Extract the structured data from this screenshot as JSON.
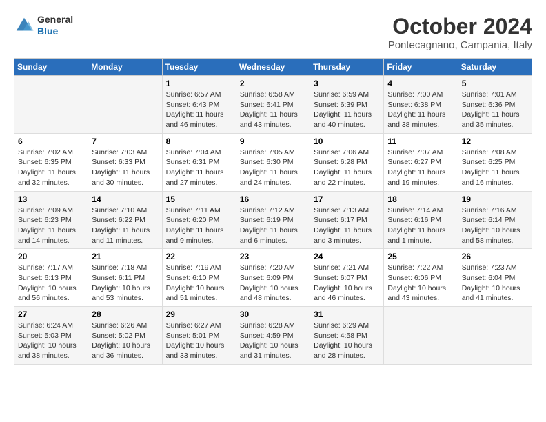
{
  "header": {
    "logo": {
      "general": "General",
      "blue": "Blue"
    },
    "title": "October 2024",
    "location": "Pontecagnano, Campania, Italy"
  },
  "weekdays": [
    "Sunday",
    "Monday",
    "Tuesday",
    "Wednesday",
    "Thursday",
    "Friday",
    "Saturday"
  ],
  "weeks": [
    [
      null,
      null,
      {
        "day": 1,
        "sunrise": "6:57 AM",
        "sunset": "6:43 PM",
        "daylight": "11 hours and 46 minutes."
      },
      {
        "day": 2,
        "sunrise": "6:58 AM",
        "sunset": "6:41 PM",
        "daylight": "11 hours and 43 minutes."
      },
      {
        "day": 3,
        "sunrise": "6:59 AM",
        "sunset": "6:39 PM",
        "daylight": "11 hours and 40 minutes."
      },
      {
        "day": 4,
        "sunrise": "7:00 AM",
        "sunset": "6:38 PM",
        "daylight": "11 hours and 38 minutes."
      },
      {
        "day": 5,
        "sunrise": "7:01 AM",
        "sunset": "6:36 PM",
        "daylight": "11 hours and 35 minutes."
      }
    ],
    [
      {
        "day": 6,
        "sunrise": "7:02 AM",
        "sunset": "6:35 PM",
        "daylight": "11 hours and 32 minutes."
      },
      {
        "day": 7,
        "sunrise": "7:03 AM",
        "sunset": "6:33 PM",
        "daylight": "11 hours and 30 minutes."
      },
      {
        "day": 8,
        "sunrise": "7:04 AM",
        "sunset": "6:31 PM",
        "daylight": "11 hours and 27 minutes."
      },
      {
        "day": 9,
        "sunrise": "7:05 AM",
        "sunset": "6:30 PM",
        "daylight": "11 hours and 24 minutes."
      },
      {
        "day": 10,
        "sunrise": "7:06 AM",
        "sunset": "6:28 PM",
        "daylight": "11 hours and 22 minutes."
      },
      {
        "day": 11,
        "sunrise": "7:07 AM",
        "sunset": "6:27 PM",
        "daylight": "11 hours and 19 minutes."
      },
      {
        "day": 12,
        "sunrise": "7:08 AM",
        "sunset": "6:25 PM",
        "daylight": "11 hours and 16 minutes."
      }
    ],
    [
      {
        "day": 13,
        "sunrise": "7:09 AM",
        "sunset": "6:23 PM",
        "daylight": "11 hours and 14 minutes."
      },
      {
        "day": 14,
        "sunrise": "7:10 AM",
        "sunset": "6:22 PM",
        "daylight": "11 hours and 11 minutes."
      },
      {
        "day": 15,
        "sunrise": "7:11 AM",
        "sunset": "6:20 PM",
        "daylight": "11 hours and 9 minutes."
      },
      {
        "day": 16,
        "sunrise": "7:12 AM",
        "sunset": "6:19 PM",
        "daylight": "11 hours and 6 minutes."
      },
      {
        "day": 17,
        "sunrise": "7:13 AM",
        "sunset": "6:17 PM",
        "daylight": "11 hours and 3 minutes."
      },
      {
        "day": 18,
        "sunrise": "7:14 AM",
        "sunset": "6:16 PM",
        "daylight": "11 hours and 1 minute."
      },
      {
        "day": 19,
        "sunrise": "7:16 AM",
        "sunset": "6:14 PM",
        "daylight": "10 hours and 58 minutes."
      }
    ],
    [
      {
        "day": 20,
        "sunrise": "7:17 AM",
        "sunset": "6:13 PM",
        "daylight": "10 hours and 56 minutes."
      },
      {
        "day": 21,
        "sunrise": "7:18 AM",
        "sunset": "6:11 PM",
        "daylight": "10 hours and 53 minutes."
      },
      {
        "day": 22,
        "sunrise": "7:19 AM",
        "sunset": "6:10 PM",
        "daylight": "10 hours and 51 minutes."
      },
      {
        "day": 23,
        "sunrise": "7:20 AM",
        "sunset": "6:09 PM",
        "daylight": "10 hours and 48 minutes."
      },
      {
        "day": 24,
        "sunrise": "7:21 AM",
        "sunset": "6:07 PM",
        "daylight": "10 hours and 46 minutes."
      },
      {
        "day": 25,
        "sunrise": "7:22 AM",
        "sunset": "6:06 PM",
        "daylight": "10 hours and 43 minutes."
      },
      {
        "day": 26,
        "sunrise": "7:23 AM",
        "sunset": "6:04 PM",
        "daylight": "10 hours and 41 minutes."
      }
    ],
    [
      {
        "day": 27,
        "sunrise": "6:24 AM",
        "sunset": "5:03 PM",
        "daylight": "10 hours and 38 minutes."
      },
      {
        "day": 28,
        "sunrise": "6:26 AM",
        "sunset": "5:02 PM",
        "daylight": "10 hours and 36 minutes."
      },
      {
        "day": 29,
        "sunrise": "6:27 AM",
        "sunset": "5:01 PM",
        "daylight": "10 hours and 33 minutes."
      },
      {
        "day": 30,
        "sunrise": "6:28 AM",
        "sunset": "4:59 PM",
        "daylight": "10 hours and 31 minutes."
      },
      {
        "day": 31,
        "sunrise": "6:29 AM",
        "sunset": "4:58 PM",
        "daylight": "10 hours and 28 minutes."
      },
      null,
      null
    ]
  ]
}
